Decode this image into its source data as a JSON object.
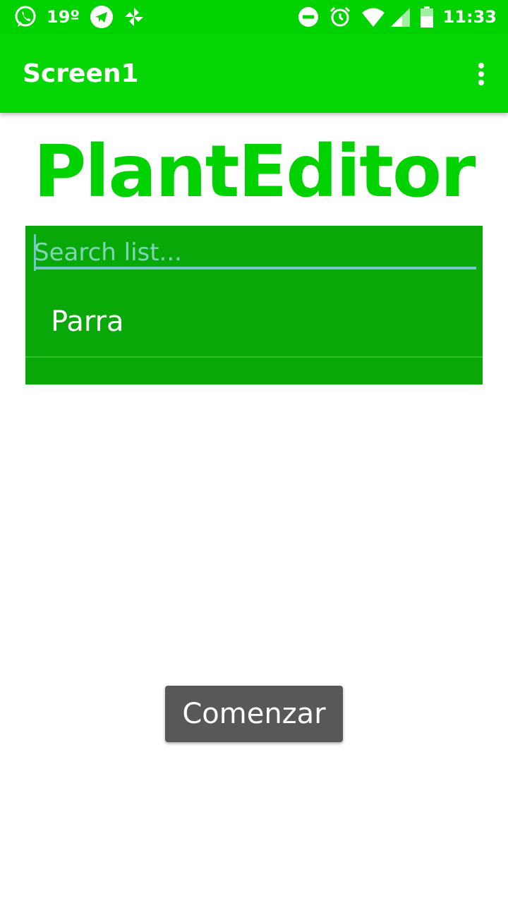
{
  "status_bar": {
    "temperature": "19º",
    "time": "11:33",
    "icons": [
      "whatsapp-icon",
      "telegram-icon",
      "pinwheel-icon",
      "do-not-disturb-icon",
      "alarm-icon",
      "wifi-icon",
      "signal-icon",
      "battery-icon"
    ]
  },
  "app_bar": {
    "title": "Screen1",
    "menu_icon": "more-vert-icon"
  },
  "main": {
    "heading": "PlantEditor",
    "search": {
      "placeholder": "Search list...",
      "value": ""
    },
    "list_items": [
      {
        "label": "Parra"
      }
    ],
    "start_button_label": "Comenzar"
  },
  "colors": {
    "status_bar": "#00d200",
    "app_bar": "#06d506",
    "heading": "#00d200",
    "list_panel": "#08a808",
    "button": "#58585a"
  }
}
